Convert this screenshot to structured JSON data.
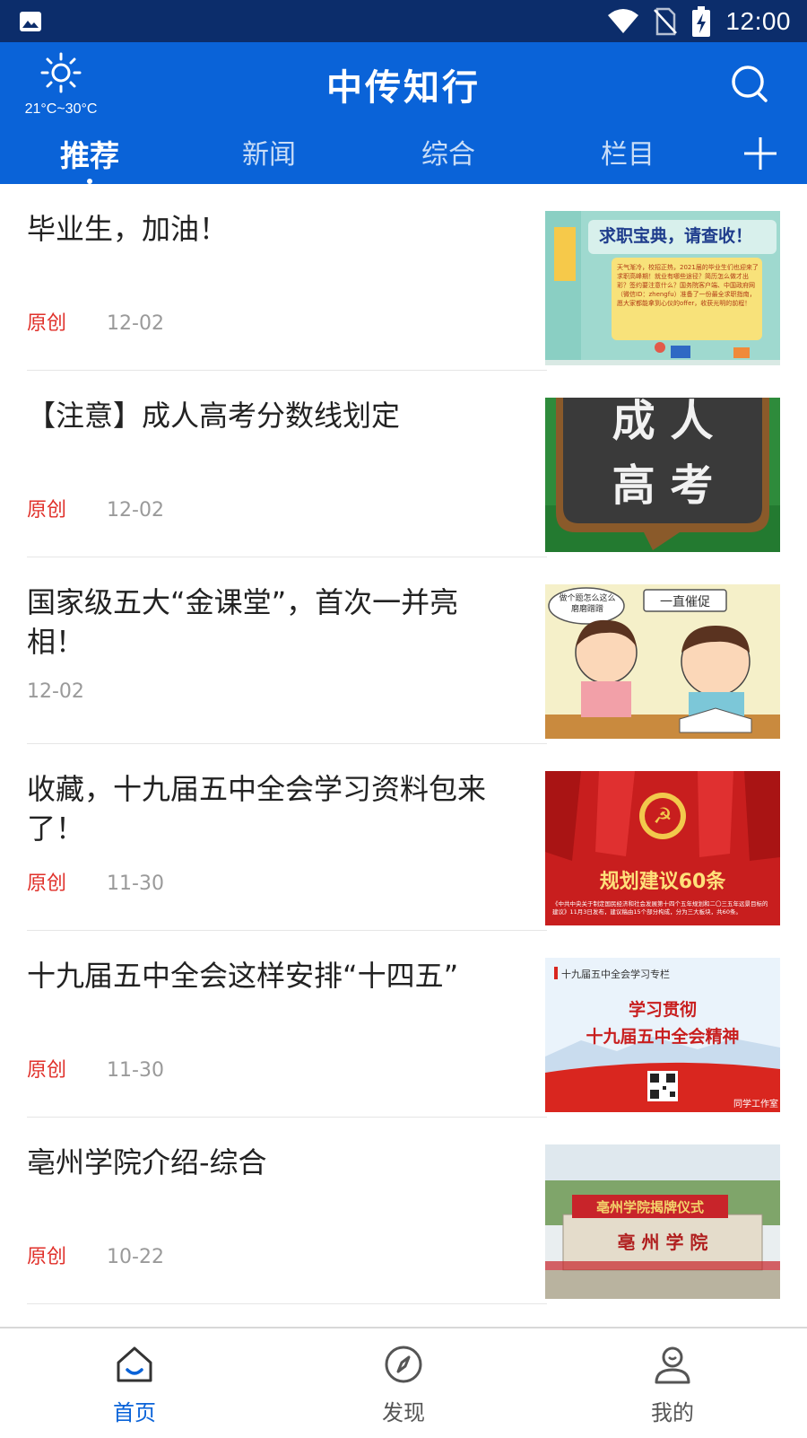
{
  "status_bar": {
    "time": "12:00"
  },
  "header": {
    "weather_temp": "21°C~30°C",
    "app_title": "中传知行"
  },
  "tabs": [
    {
      "label": "推荐",
      "active": true
    },
    {
      "label": "新闻"
    },
    {
      "label": "综合"
    },
    {
      "label": "栏目"
    }
  ],
  "feed": [
    {
      "title": "毕业生，加油！",
      "tag": "原创",
      "date": "12-02",
      "thumb_text": [
        "求职宝典，请查收！",
        "天气渐冷，校招正热，2021届的毕业生们也迎来了求职高峰期！就业有哪些途径？简历怎么做才出彩？签约要注意什么？国务院客户端、中国政府网（微信ID：zhengfu）准备了一份最全求职指南，愿大家都能拿到心仪的offer，收获光明的前程！"
      ]
    },
    {
      "title": "【注意】成人高考分数线划定",
      "tag": "原创",
      "date": "12-02",
      "thumb_text": [
        "成 人",
        "高 考"
      ]
    },
    {
      "title": "国家级五大“金课堂”，首次一并亮相！",
      "tag": "",
      "date": "12-02",
      "thumb_text": [
        "一直催促",
        "做个题怎么这么磨磨蹭蹭"
      ]
    },
    {
      "title": "收藏，十九届五中全会学习资料包来了！",
      "tag": "原创",
      "date": "11-30",
      "thumb_text": [
        "规划建议60条",
        "《中共中央关于制定国民经济和社会发展第十四个五年规划和二〇三五年远景目标的建议》11月3日发布，建议稿由15个部分构成，分为三大板块，共60条。"
      ]
    },
    {
      "title": "十九届五中全会这样安排“十四五”",
      "tag": "原创",
      "date": "11-30",
      "thumb_text": [
        "十九届五中全会学习专栏",
        "学习贯彻",
        "十九届五中全会精神",
        "同学工作室"
      ]
    },
    {
      "title": "亳州学院介绍-综合",
      "tag": "原创",
      "date": "10-22",
      "thumb_text": [
        "亳州学院揭牌仪式",
        "亳 州 学 院"
      ]
    }
  ],
  "bottom_nav": [
    {
      "label": "首页",
      "icon": "home-icon",
      "active": true
    },
    {
      "label": "发现",
      "icon": "compass-icon"
    },
    {
      "label": "我的",
      "icon": "user-icon"
    }
  ],
  "colors": {
    "status_bar": "#0c2d6b",
    "header": "#0a63d8",
    "accent_red": "#e0312b",
    "active_nav": "#0a63d8"
  }
}
